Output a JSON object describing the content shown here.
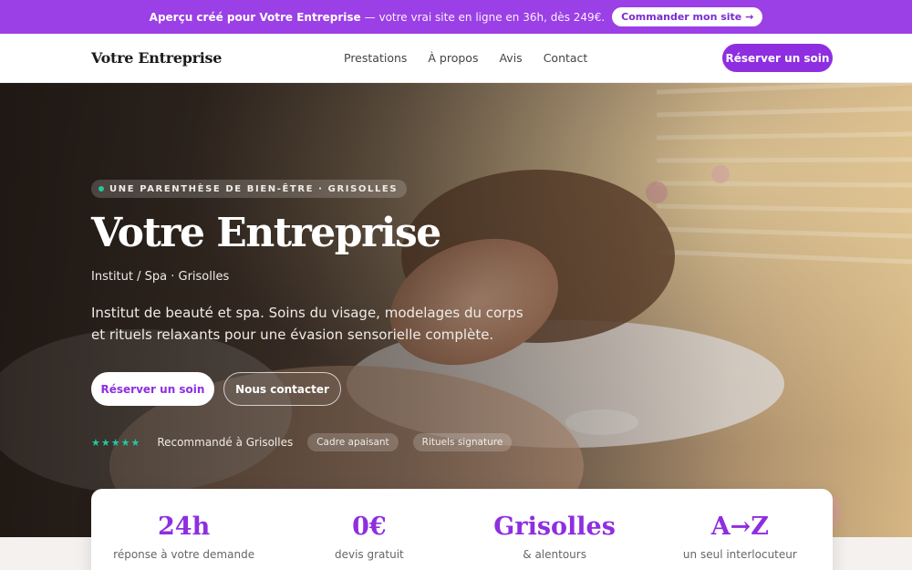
{
  "promo": {
    "bold": "Aperçu créé pour Votre Entreprise",
    "rest": "— votre vrai site en ligne en 36h, dès 249€.",
    "cta": "Commander mon site →"
  },
  "nav": {
    "brand": "Votre Entreprise",
    "links": [
      "Prestations",
      "À propos",
      "Avis",
      "Contact"
    ],
    "cta": "Réserver un soin"
  },
  "hero": {
    "tagline": "UNE PARENTHÈSE DE BIEN-ÊTRE · GRISOLLES",
    "title": "Votre Entreprise",
    "subtitle": "Institut / Spa · Grisolles",
    "description": "Institut de beauté et spa. Soins du visage, modelages du corps et rituels relaxants pour une évasion sensorielle complète.",
    "primary_button": "Réserver un soin",
    "secondary_button": "Nous contacter",
    "stars": "★★★★★",
    "recommendation": "Recommandé à Grisolles",
    "chips": [
      "Cadre apaisant",
      "Rituels signature"
    ]
  },
  "stats": [
    {
      "value": "24h",
      "label": "réponse à votre demande"
    },
    {
      "value": "0€",
      "label": "devis gratuit"
    },
    {
      "value": "Grisolles",
      "label": "& alentours"
    },
    {
      "value": "A→Z",
      "label": "un seul interlocuteur"
    }
  ],
  "colors": {
    "accent": "#8e2ee0",
    "banner": "#9b3fe6",
    "teal": "#22c8a0"
  }
}
